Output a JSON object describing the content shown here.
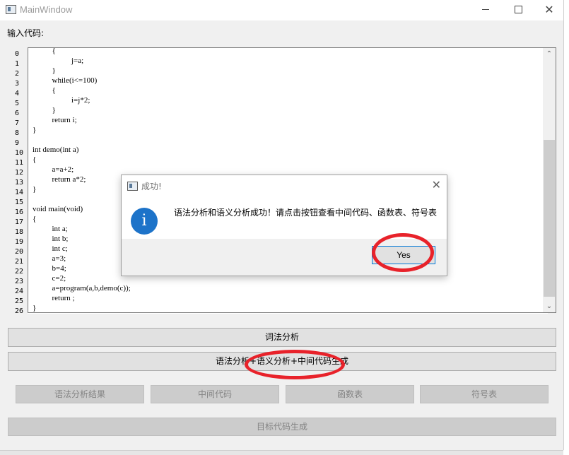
{
  "window": {
    "title": "MainWindow",
    "minimize": "",
    "maximize": "",
    "close": "✕"
  },
  "input_label": "输入代码:",
  "editor": {
    "line_numbers": [
      "0",
      "1",
      "2",
      "3",
      "4",
      "5",
      "6",
      "7",
      "8",
      "9",
      "10",
      "11",
      "12",
      "13",
      "14",
      "15",
      "16",
      "17",
      "18",
      "19",
      "20",
      "21",
      "22",
      "23",
      "24",
      "25",
      "26"
    ],
    "lines": [
      "          {",
      "                    j=a;",
      "          }",
      "          while(i<=100)",
      "          {",
      "                    i=j*2;",
      "          }",
      "          return i;",
      "}",
      "",
      "int demo(int a)",
      "{",
      "          a=a+2;",
      "          return a*2;",
      "}",
      "",
      "void main(void)",
      "{",
      "          int a;",
      "          int b;",
      "          int c;",
      "          a=3;",
      "          b=4;",
      "          c=2;",
      "          a=program(a,b,demo(c));",
      "          return ;",
      "}"
    ],
    "scroll_up": "⌃",
    "scroll_down": "⌄"
  },
  "buttons": {
    "lexical": "词法分析",
    "syntax_semantic": "语法分析+语义分析+中间代码生成",
    "syntax_result": "语法分析结果",
    "intermediate_code": "中间代码",
    "function_table": "函数表",
    "symbol_table": "符号表",
    "target_code": "目标代码生成"
  },
  "dialog": {
    "title": "成功!",
    "close": "✕",
    "icon_glyph": "i",
    "message": "语法分析和语义分析成功！请点击按钮查看中间代码、函数表、符号表",
    "yes": "Yes"
  },
  "colors": {
    "annotation": "#e8222a",
    "info_icon": "#1d73c9",
    "focus_border": "#0078d7"
  }
}
